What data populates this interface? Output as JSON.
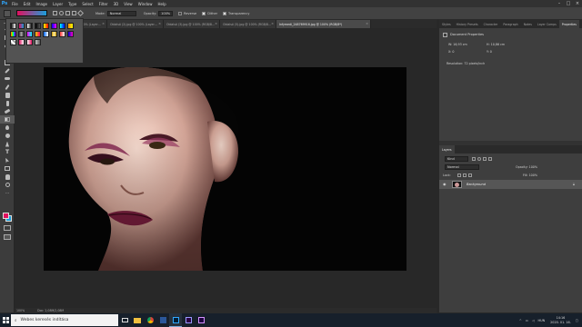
{
  "app": {
    "logo": "Ps"
  },
  "menu": [
    "File",
    "Edit",
    "Image",
    "Layer",
    "Type",
    "Select",
    "Filter",
    "3D",
    "View",
    "Window",
    "Help"
  ],
  "options": {
    "mode_label": "Mode:",
    "mode_value": "Normal",
    "opacity_label": "Opacity:",
    "opacity_value": "100%",
    "reverse_label": "Reverse",
    "dither_label": "Dither",
    "transparency_label": "Transparency"
  },
  "tabs": [
    {
      "label": "100% (RGB/8)* ×"
    },
    {
      "label": "Oldalsó (2).jpg @ 100% (Layer…"
    },
    {
      "label": "Oldalsó (2).jpg @ 100% (Layer…"
    },
    {
      "label": "Oldalsó (3).jpg @ 100% (RGB/8…"
    },
    {
      "label": "Oldalsó (5).jpg @ 100% (RGB/8…"
    },
    {
      "label": "Infymedi_248769916.jpg @ 100% (RGB/8*)"
    }
  ],
  "status": {
    "zoom": "100%",
    "doc": "Doc: 2,08M/2,08M"
  },
  "right_panel_tabs": [
    "Styles",
    "History Presets",
    "Character",
    "Paragraph",
    "Notes",
    "Layer Comps",
    "Properties"
  ],
  "properties": {
    "title": "Document Properties",
    "w": "W: 16,93 cm",
    "h": "H: 10,86 cm",
    "x": "X: 0",
    "y": "Y: 0",
    "resolution": "Resolution: 72 pixels/inch"
  },
  "layers": {
    "tab": "Layers",
    "kind": "Kind",
    "blend": "Normal",
    "opacity": "Opacity: 100%",
    "lock": "Lock:",
    "fill": "Fill: 100%",
    "layer_name": "Background"
  },
  "taskbar": {
    "search": "Webes keresés indítása",
    "lang": "HUN",
    "time": "14:16",
    "date": "2020. 01. 16."
  },
  "colors": {
    "foreground": "#e0115f",
    "background": "#1a9dd9",
    "accent": "#31a8ff"
  }
}
